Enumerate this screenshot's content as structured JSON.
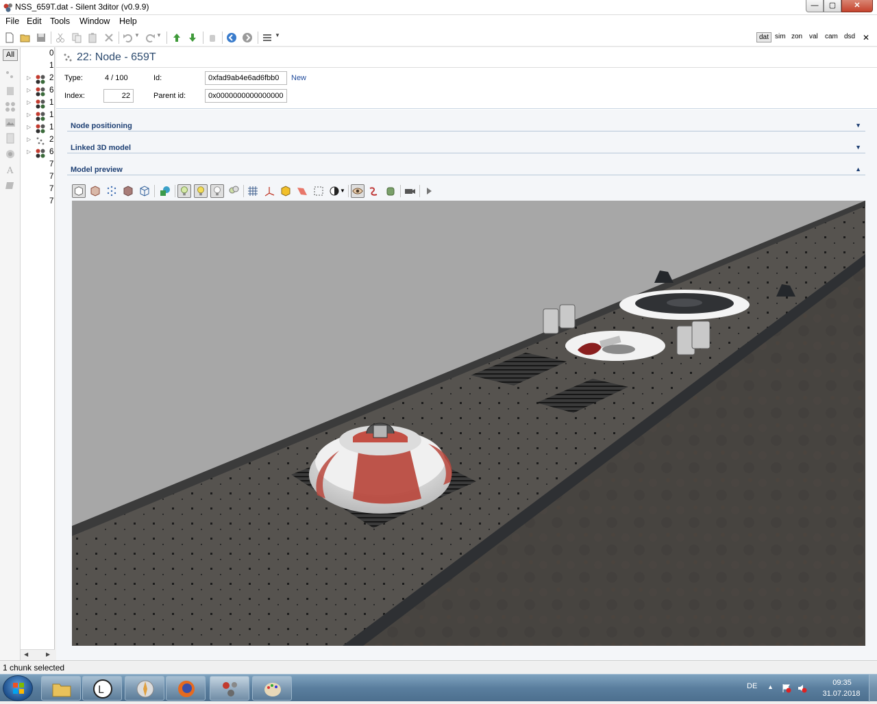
{
  "window": {
    "title": "NSS_659T.dat - Silent 3ditor (v0.9.9)",
    "minimize": "—",
    "maximize": "▢",
    "close": "✕"
  },
  "menu": [
    "File",
    "Edit",
    "Tools",
    "Window",
    "Help"
  ],
  "modes": [
    "dat",
    "sim",
    "zon",
    "val",
    "cam",
    "dsd"
  ],
  "active_mode": "dat",
  "left_strip": {
    "all_label": "All"
  },
  "tree": {
    "rows": [
      {
        "label": "0",
        "icon": ""
      },
      {
        "label": "1",
        "icon": ""
      },
      {
        "label": "2",
        "icon": "node-balls-icon"
      },
      {
        "label": "6",
        "icon": "node-balls-icon"
      },
      {
        "label": "1",
        "icon": "node-balls-icon"
      },
      {
        "label": "1",
        "icon": "node-balls-icon"
      },
      {
        "label": "1",
        "icon": "node-balls-icon"
      },
      {
        "label": "2",
        "icon": "node-dots-icon"
      },
      {
        "label": "6",
        "icon": "node-balls-icon"
      },
      {
        "label": "7",
        "icon": ""
      },
      {
        "label": "7",
        "icon": ""
      },
      {
        "label": "7",
        "icon": ""
      },
      {
        "label": "7",
        "icon": ""
      }
    ]
  },
  "header": {
    "title": "22: Node - 659T"
  },
  "props": {
    "type_label": "Type:",
    "type_value": "4 / 100",
    "id_label": "Id:",
    "id_value": "0xfad9ab4e6ad6fbb0",
    "new_link": "New",
    "index_label": "Index:",
    "index_value": "22",
    "parent_label": "Parent id:",
    "parent_value": "0x0000000000000000"
  },
  "sections": [
    {
      "title": "Node positioning",
      "arrow": "▼"
    },
    {
      "title": "Linked 3D model",
      "arrow": "▼"
    },
    {
      "title": "Model preview",
      "arrow": "▲"
    }
  ],
  "status": {
    "text": "1 chunk selected"
  },
  "taskbar": {
    "language": "DE",
    "time": "09:35",
    "date": "31.07.2018"
  },
  "colors": {
    "accent": "#1d3f73",
    "sky": "#a6a6a6",
    "hull": "#4a4744",
    "deck": "#55524e",
    "stripe_red": "#b9473c"
  }
}
